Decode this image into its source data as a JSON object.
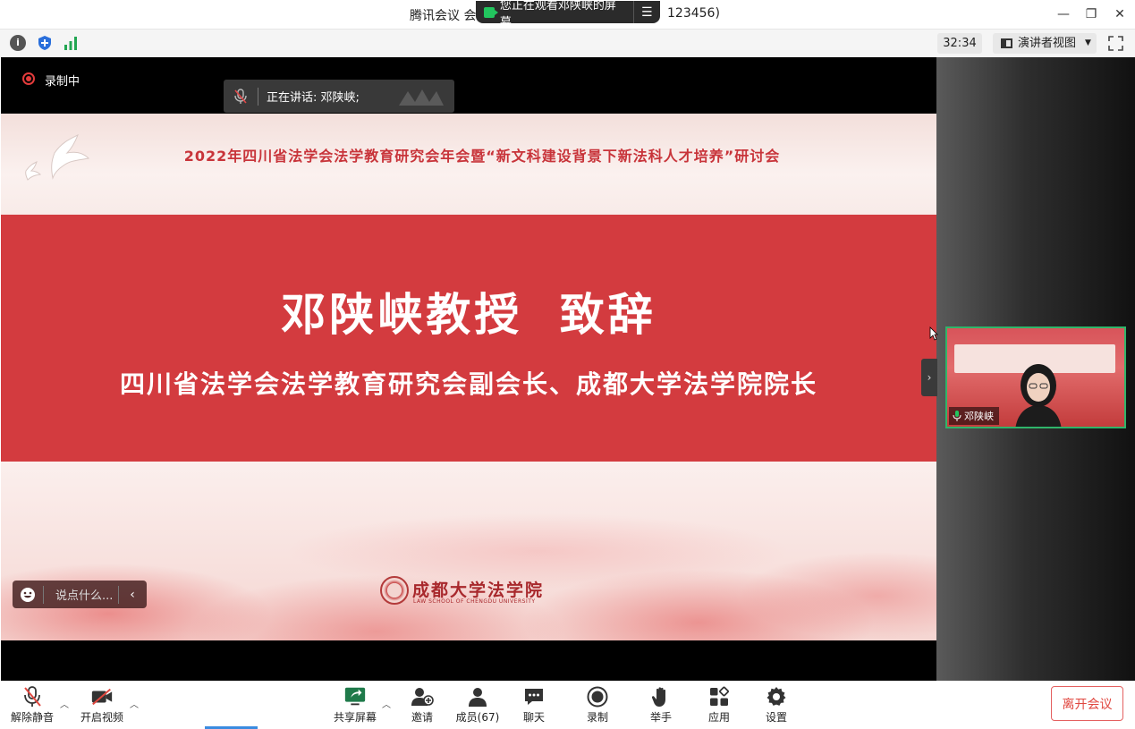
{
  "window": {
    "title_prefix": "腾讯会议 会",
    "title_suffix": "123456)",
    "viewing_notice": "您正在观看邓陕峡的屏幕",
    "controls": {
      "minimize": "—",
      "restore": "❐",
      "close": "✕"
    }
  },
  "infobar": {
    "timer": "32:34",
    "view_mode": "演讲者视图",
    "info_icon": "i"
  },
  "stage": {
    "recording_label": "录制中",
    "speaking_label": "正在讲话: 邓陕峡;"
  },
  "slide": {
    "header": "2022年四川省法学会法学教育研究会年会暨“新文科建设背景下新法科人才培养”研讨会",
    "title": "邓陕峡教授  致辞",
    "subtitle": "四川省法学会法学教育研究会副会长、成都大学法学院院长",
    "school_name": "成都大学法学院",
    "school_name_en": "LAW SCHOOL OF CHENGDU UNIVERSITY"
  },
  "chat": {
    "placeholder": "说点什么...",
    "collapse": "‹"
  },
  "participant": {
    "name": "邓陕峡"
  },
  "toolbar": {
    "unmute": "解除静音",
    "start_video": "开启视频",
    "share_screen": "共享屏幕",
    "invite": "邀请",
    "members": "成员(67)",
    "chat": "聊天",
    "record": "录制",
    "raise_hand": "举手",
    "apps": "应用",
    "settings": "设置",
    "leave": "离开会议"
  },
  "colors": {
    "accent_green": "#22c55e",
    "slide_red": "#d33b3f",
    "leave_red": "#e0473f",
    "recording_red": "#e23b3b"
  }
}
